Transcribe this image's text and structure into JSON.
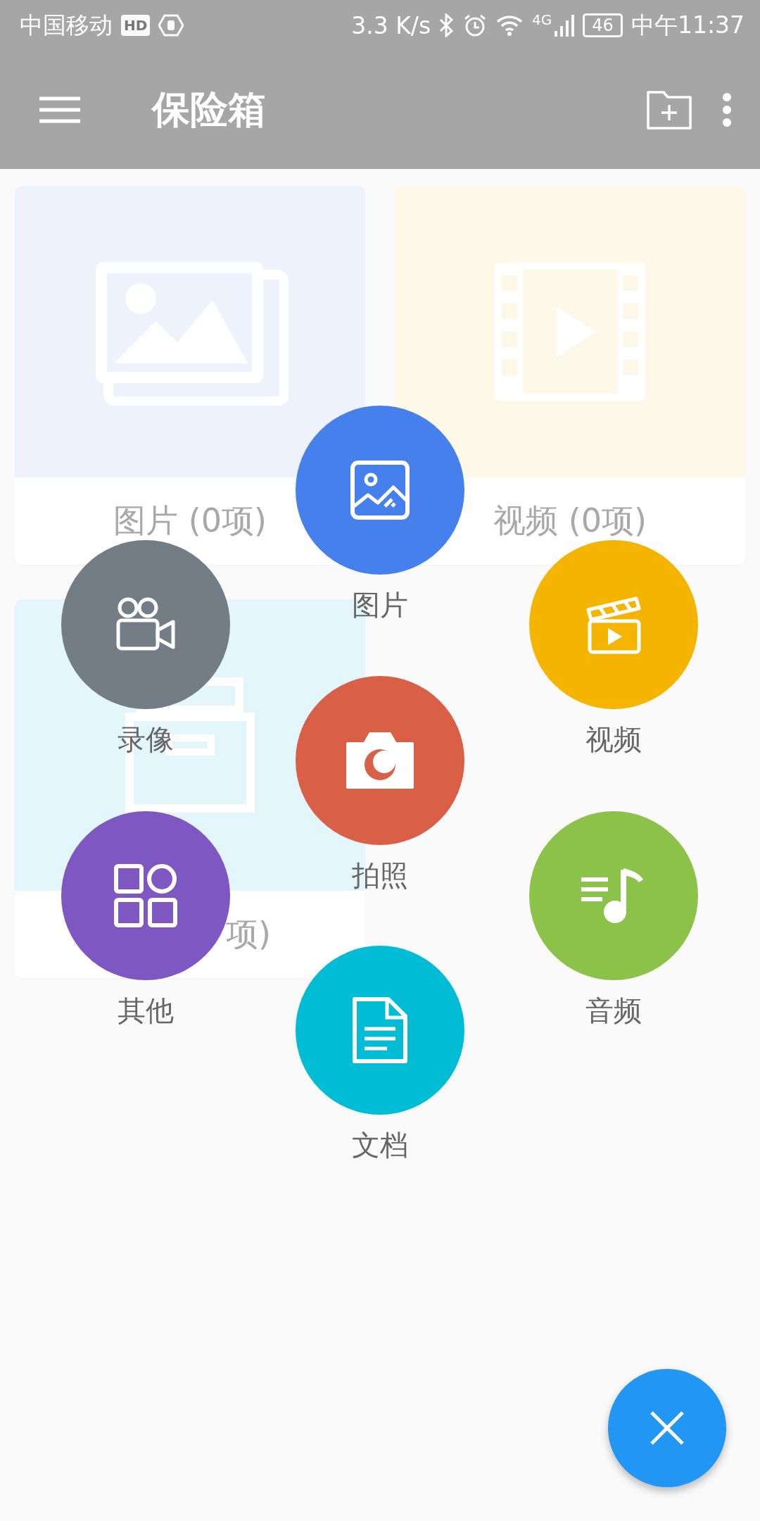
{
  "status_bar": {
    "carrier": "中国移动",
    "hd_badge": "HD",
    "speed": "3.3 K/s",
    "network": "4G",
    "battery": "46",
    "time": "中午11:37"
  },
  "app_bar": {
    "title": "保险箱"
  },
  "cards": [
    {
      "kind": "image",
      "label": "图片 (0项)"
    },
    {
      "kind": "video",
      "label": "视频 (0项)"
    },
    {
      "kind": "box",
      "label": "项)"
    }
  ],
  "fan_menu": [
    {
      "kind": "image",
      "label": "图片",
      "color": "#4680ec"
    },
    {
      "kind": "camcorder",
      "label": "录像",
      "color": "#727d86"
    },
    {
      "kind": "video",
      "label": "视频",
      "color": "#f4b400"
    },
    {
      "kind": "camera",
      "label": "拍照",
      "color": "#d95f46"
    },
    {
      "kind": "other",
      "label": "其他",
      "color": "#7e57c2"
    },
    {
      "kind": "audio",
      "label": "音频",
      "color": "#8bc34a"
    },
    {
      "kind": "document",
      "label": "文档",
      "color": "#00bcd4"
    }
  ]
}
